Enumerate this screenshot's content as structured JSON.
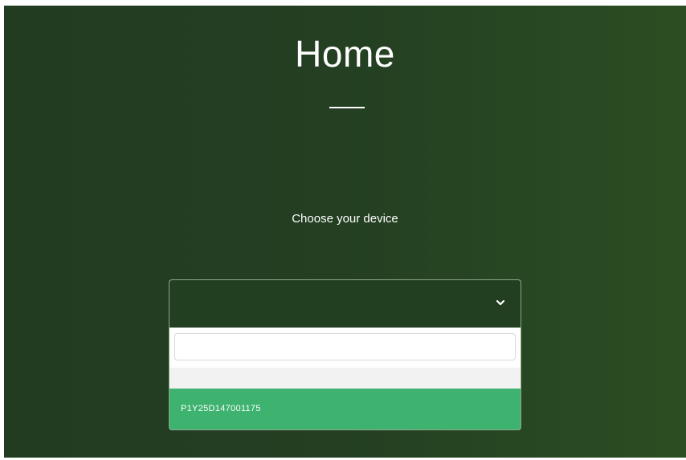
{
  "page": {
    "title": "Home",
    "choose_label": "Choose your device"
  },
  "device_select": {
    "selected_value": "",
    "search": {
      "value": "",
      "placeholder": ""
    },
    "options": [
      {
        "label": ""
      },
      {
        "label": "P1Y25D147001175",
        "highlighted": true
      }
    ],
    "icon": "chevron-down-icon"
  },
  "colors": {
    "background": "#243f22",
    "option_highlight": "#3db36f",
    "text": "#ffffff"
  }
}
